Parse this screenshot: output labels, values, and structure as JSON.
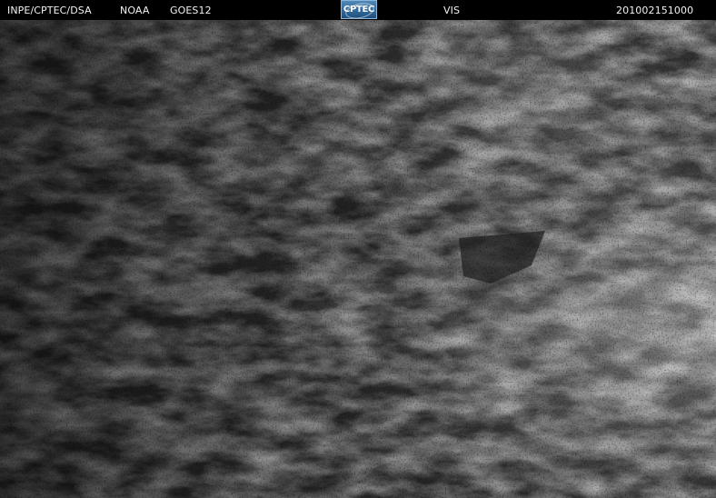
{
  "header": {
    "institution": "INPE/CPTEC/DSA",
    "agency": "NOAA",
    "satellite": "GOES12",
    "logo_text": "CPTEC",
    "channel": "VIS",
    "timestamp": "201002151000"
  },
  "imagery": {
    "channel": "VIS",
    "palette": "grayscale"
  }
}
